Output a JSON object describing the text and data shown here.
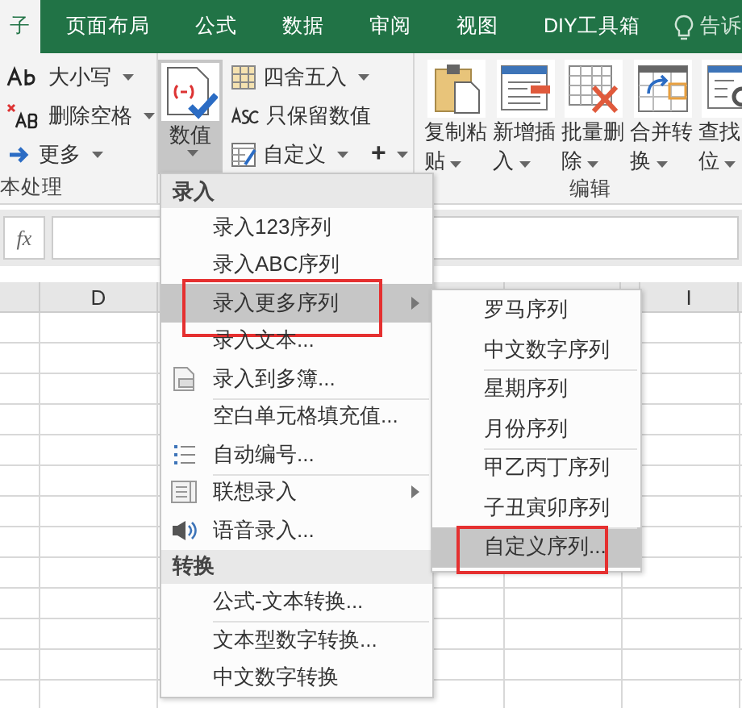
{
  "tabs": [
    {
      "label": "子",
      "selected": true
    },
    {
      "label": "页面布局",
      "selected": false
    },
    {
      "label": "公式",
      "selected": false
    },
    {
      "label": "数据",
      "selected": false
    },
    {
      "label": "审阅",
      "selected": false
    },
    {
      "label": "视图",
      "selected": false
    },
    {
      "label": "DIY工具箱",
      "selected": false
    }
  ],
  "tell_me": "告诉",
  "ribbon": {
    "text_group": {
      "label": "本处理",
      "buttons": [
        {
          "kind": "case",
          "label": "大小写"
        },
        {
          "kind": "trim",
          "label": "删除空格"
        },
        {
          "kind": "more",
          "label": "更多"
        }
      ]
    },
    "number_group": {
      "large_button": {
        "label": "数值",
        "pressed": true
      },
      "buttons": [
        {
          "kind": "round",
          "label": "四舍五入"
        },
        {
          "kind": "asc",
          "label": "只保留数值"
        },
        {
          "kind": "custom",
          "label": "自定义"
        }
      ],
      "add_button": "+"
    },
    "edit_group": {
      "label": "编辑",
      "buttons": [
        {
          "kind": "paste",
          "lines": [
            "复制粘",
            "贴"
          ]
        },
        {
          "kind": "insert",
          "lines": [
            "新增插",
            "入"
          ]
        },
        {
          "kind": "delete",
          "lines": [
            "批量删",
            "除"
          ]
        },
        {
          "kind": "merge",
          "lines": [
            "合并转",
            "换"
          ]
        },
        {
          "kind": "find",
          "lines": [
            "查找",
            "位"
          ]
        }
      ]
    }
  },
  "formula_bar": {
    "fx": "fx"
  },
  "column_headers": [
    "D",
    "I"
  ],
  "menu": {
    "sections": [
      {
        "header": "录入",
        "items": [
          {
            "label": "录入123序列",
            "kind": "plain",
            "divider_before": false,
            "submenu": false,
            "highlighted": false,
            "outlined": false
          },
          {
            "label": "录入ABC序列",
            "kind": "plain",
            "divider_before": false,
            "submenu": false,
            "highlighted": false,
            "outlined": false
          },
          {
            "label": "录入更多序列",
            "kind": "plain",
            "divider_before": false,
            "submenu": true,
            "highlighted": true,
            "outlined": true
          },
          {
            "label": "录入文本...",
            "kind": "plain",
            "divider_before": false,
            "submenu": false,
            "highlighted": false,
            "outlined": false
          },
          {
            "label": "录入到多簿...",
            "kind": "sheets",
            "divider_before": false,
            "submenu": false,
            "highlighted": false,
            "outlined": false
          },
          {
            "label": "空白单元格填充值...",
            "kind": "plain",
            "divider_before": true,
            "submenu": false,
            "highlighted": false,
            "outlined": false
          },
          {
            "label": "自动编号...",
            "kind": "numbering",
            "divider_before": false,
            "submenu": false,
            "highlighted": false,
            "outlined": false
          },
          {
            "label": "联想录入",
            "kind": "suggest",
            "divider_before": true,
            "submenu": true,
            "highlighted": false,
            "outlined": false
          },
          {
            "label": "语音录入...",
            "kind": "speaker",
            "divider_before": false,
            "submenu": false,
            "highlighted": false,
            "outlined": false
          }
        ]
      },
      {
        "header": "转换",
        "items": [
          {
            "label": "公式-文本转换...",
            "kind": "plain",
            "divider_before": false,
            "submenu": false,
            "highlighted": false,
            "outlined": false
          },
          {
            "label": "文本型数字转换...",
            "kind": "plain",
            "divider_before": true,
            "submenu": false,
            "highlighted": false,
            "outlined": false
          },
          {
            "label": "中文数字转换",
            "kind": "plain",
            "divider_before": false,
            "submenu": false,
            "highlighted": false,
            "outlined": false
          }
        ]
      }
    ]
  },
  "submenu": {
    "items": [
      {
        "label": "罗马序列",
        "divider_before": false,
        "highlighted": false,
        "outlined": false
      },
      {
        "label": "中文数字序列",
        "divider_before": false,
        "highlighted": false,
        "outlined": false
      },
      {
        "label": "星期序列",
        "divider_before": true,
        "highlighted": false,
        "outlined": false
      },
      {
        "label": "月份序列",
        "divider_before": false,
        "highlighted": false,
        "outlined": false
      },
      {
        "label": "甲乙丙丁序列",
        "divider_before": true,
        "highlighted": false,
        "outlined": false
      },
      {
        "label": "子丑寅卯序列",
        "divider_before": false,
        "highlighted": false,
        "outlined": false
      },
      {
        "label": "自定义序列...",
        "divider_before": true,
        "highlighted": true,
        "outlined": true
      }
    ]
  }
}
